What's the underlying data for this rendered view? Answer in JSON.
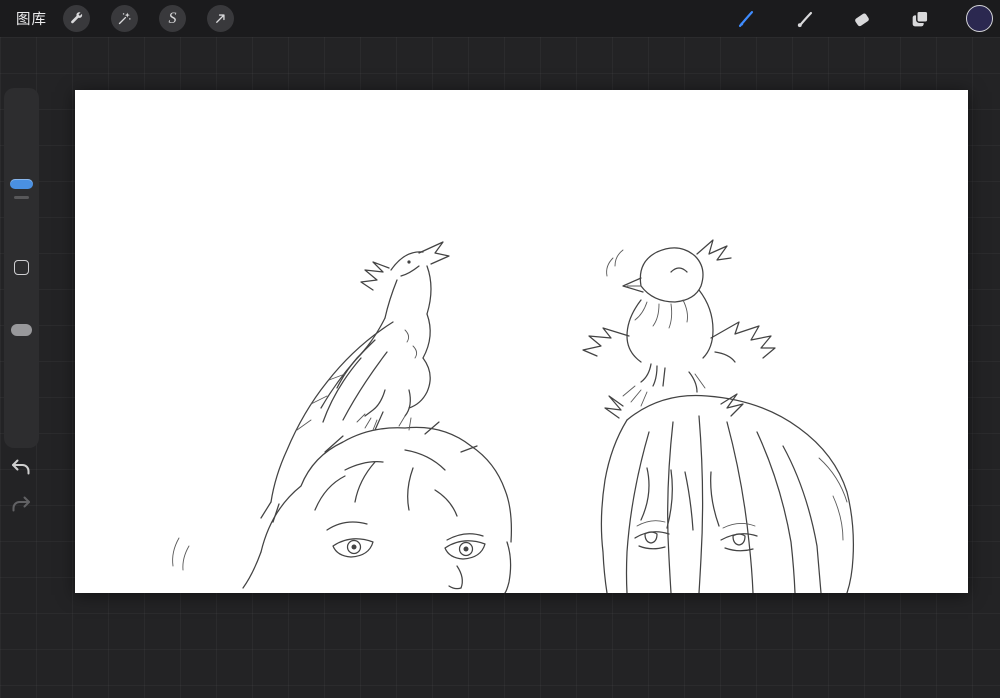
{
  "topbar": {
    "gallery_label": "图库",
    "left_tools": [
      {
        "id": "actions",
        "icon": "wrench-icon"
      },
      {
        "id": "adjustments",
        "icon": "magic-wand-icon"
      },
      {
        "id": "selection",
        "icon": "selection-s-icon",
        "glyph": "S"
      },
      {
        "id": "transform",
        "icon": "transform-arrow-icon"
      }
    ],
    "right_tools": [
      {
        "id": "paint",
        "icon": "paintbrush-icon",
        "selected": true,
        "color": "#3f8cff"
      },
      {
        "id": "smudge",
        "icon": "smudge-icon"
      },
      {
        "id": "erase",
        "icon": "eraser-icon"
      },
      {
        "id": "layers",
        "icon": "layers-icon"
      },
      {
        "id": "color",
        "icon": "color-swatch",
        "value": "#2b2850"
      }
    ]
  },
  "sidebar": {
    "size_slider": {
      "handle_color": "#4a90e2"
    },
    "opacity_slider": {
      "handle_color": "#98989b"
    }
  },
  "canvas": {
    "background": "#ffffff",
    "artwork_description": "pencil line sketch: a small dragon perched on a spiky-haired head (left) and a small bird perched on a long-haired head (right), only eyes of both people visible"
  },
  "colors": {
    "topbar_bg": "#1b1b1d",
    "workspace_bg": "#232325",
    "panel_bg": "#2d2d2f"
  }
}
